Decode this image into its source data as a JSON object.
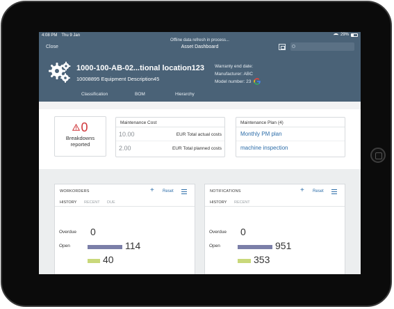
{
  "status_bar": {
    "time": "4:08 PM",
    "date": "Thu 9 Jan",
    "battery": "29%",
    "battery_level": 0.29
  },
  "header": {
    "offline_notice": "Offline data refresh in process...",
    "close_label": "Close",
    "title": "Asset Dashboard",
    "search_placeholder": "",
    "equipment_title": "1000-100-AB-02...tional location123",
    "equipment_description": "10008895 Equipment Description45",
    "warranty_label": "Warranty end date:",
    "manufacturer_label": "Manufacturer: ABC",
    "model_label": "Model number: 23",
    "tabs": [
      {
        "label": "Classification"
      },
      {
        "label": "BOM"
      },
      {
        "label": "Hierarchy"
      }
    ]
  },
  "summary": {
    "breakdowns_count": "0",
    "breakdowns_label_1": "Breakdowns",
    "breakdowns_label_2": "reported",
    "cost_card": {
      "title": "Maintenance Cost",
      "rows": [
        {
          "value": "10.00",
          "label": "EUR Total actual costs"
        },
        {
          "value": "2.00",
          "label": "EUR Total planned costs"
        }
      ]
    },
    "plan_card": {
      "title": "Maintenance Plan (4)",
      "items": [
        {
          "label": "Monthly PM plan"
        },
        {
          "label": "machine inspection"
        }
      ]
    }
  },
  "workorders": {
    "title": "WORKORDERS",
    "add_label": "+",
    "reset_label": "Reset",
    "tabs": [
      "HISTORY",
      "RECENT",
      "DUE"
    ],
    "stats": [
      {
        "label": "Overdue",
        "value": "0",
        "amount": 0
      },
      {
        "label": "Open",
        "value": "114",
        "amount": 114
      },
      {
        "label": "",
        "value": "40",
        "amount": 40
      }
    ]
  },
  "notifications": {
    "title": "NOTIFICATIONS",
    "add_label": "+",
    "reset_label": "Reset",
    "tabs": [
      "HISTORY",
      "RECENT"
    ],
    "stats": [
      {
        "label": "Overdue",
        "value": "0",
        "amount": 0
      },
      {
        "label": "Open",
        "value": "951",
        "amount": 951
      },
      {
        "label": "",
        "value": "353",
        "amount": 353
      }
    ]
  },
  "colors": {
    "header_bg": "#4a6277",
    "accent": "#2b6ca8",
    "alert": "#d0363a",
    "bar_open": "#7b7fa8",
    "bar_third": "#c9d87a"
  }
}
